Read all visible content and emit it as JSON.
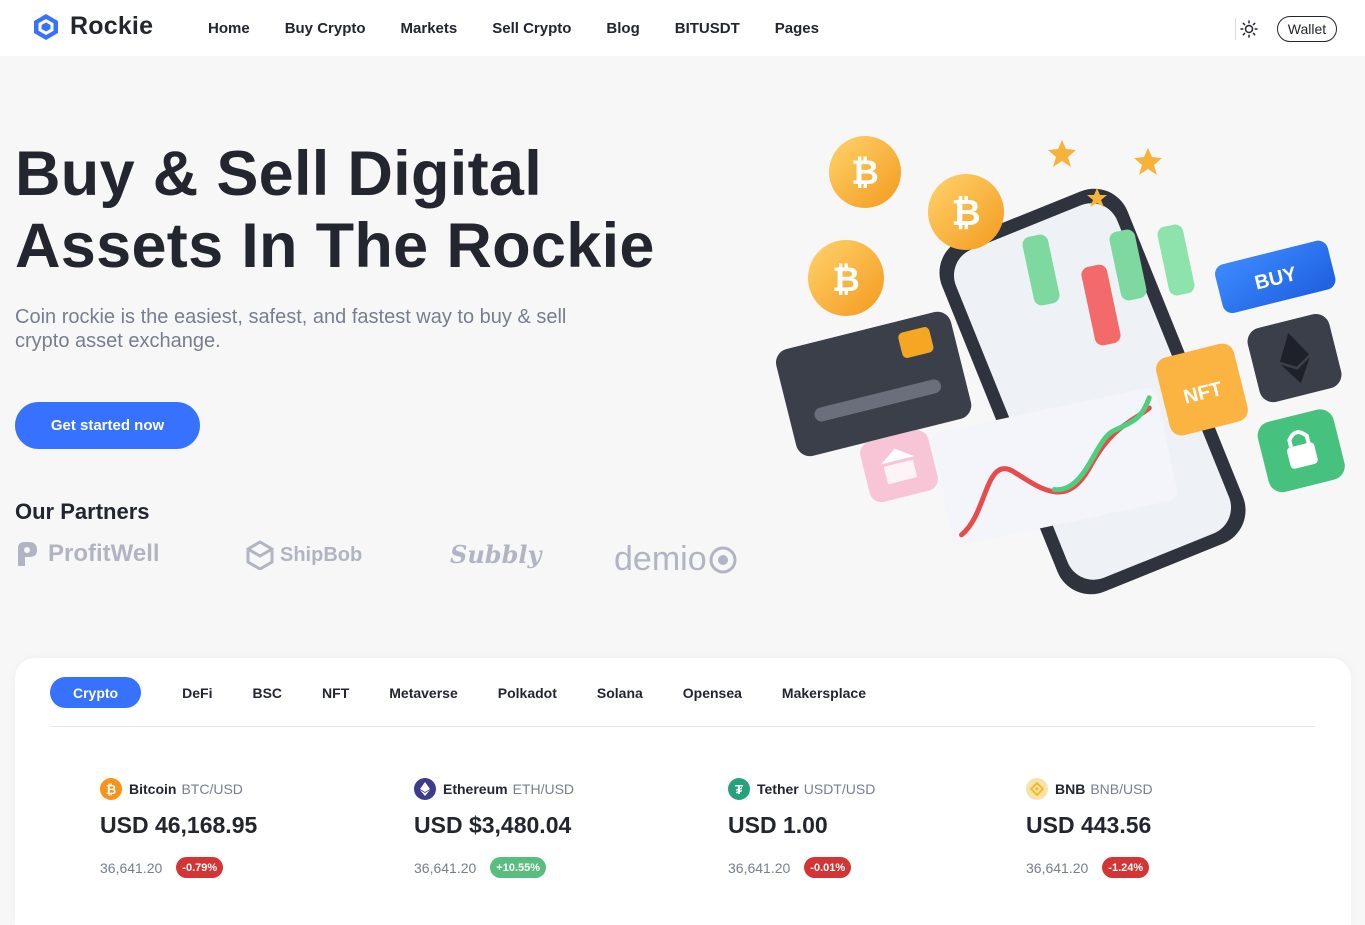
{
  "header": {
    "brand": "Rockie",
    "nav": [
      "Home",
      "Buy Crypto",
      "Markets",
      "Sell Crypto",
      "Blog",
      "BITUSDT",
      "Pages"
    ],
    "wallet_label": "Wallet"
  },
  "hero": {
    "title_line1": "Buy & Sell Digital",
    "title_line2": "Assets In The Rockie",
    "subtitle": "Coin rockie is the easiest, safest, and fastest way to buy & sell crypto asset exchange.",
    "cta_label": "Get started now",
    "partners_title": "Our Partners",
    "partners": [
      "ProfitWell",
      "ShipBob",
      "Subbly",
      "demio"
    ],
    "illustration_labels": {
      "buy": "BUY",
      "nft": "NFT"
    }
  },
  "market": {
    "tabs": [
      "Crypto",
      "DeFi",
      "BSC",
      "NFT",
      "Metaverse",
      "Polkadot",
      "Solana",
      "Opensea",
      "Makersplace"
    ],
    "active_tab": "Crypto",
    "coins": [
      {
        "icon": "bitcoin-icon",
        "name": "Bitcoin",
        "pair": "BTC/USD",
        "price": "USD 46,168.95",
        "volume": "36,641.20",
        "change": "-0.79%",
        "color": "#f7931a",
        "change_color": "#d33535"
      },
      {
        "icon": "ethereum-icon",
        "name": "Ethereum",
        "pair": "ETH/USD",
        "price": "USD $3,480.04",
        "volume": "36,641.20",
        "change": "+10.55%",
        "color": "#5c6bc0",
        "change_color": "#58bd7d"
      },
      {
        "icon": "tether-icon",
        "name": "Tether",
        "pair": "USDT/USD",
        "price": "USD 1.00",
        "volume": "36,641.20",
        "change": "-0.01%",
        "color": "#26a17b",
        "change_color": "#d33535"
      },
      {
        "icon": "bnb-icon",
        "name": "BNB",
        "pair": "BNB/USD",
        "price": "USD 443.56",
        "volume": "36,641.20",
        "change": "-1.24%",
        "color": "#f3ba2f",
        "change_color": "#d33535"
      }
    ]
  },
  "colors": {
    "accent": "#3772ff",
    "text": "#23262f",
    "muted": "#777e90"
  }
}
